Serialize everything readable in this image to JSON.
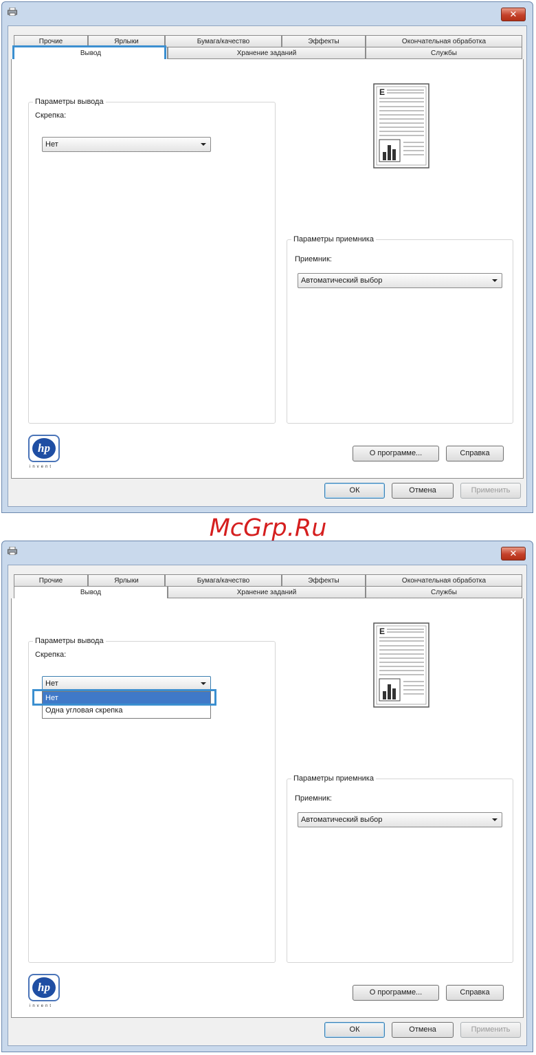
{
  "watermark": "McGrp.Ru",
  "titlebar": {
    "close_label": "✕"
  },
  "tabs": {
    "row1": [
      "Прочие",
      "Ярлыки",
      "Бумага/качество",
      "Эффекты",
      "Окончательная обработка"
    ],
    "row2": [
      "Вывод",
      "Хранение заданий",
      "Службы"
    ]
  },
  "output_group": {
    "title": "Параметры вывода",
    "staple_label": "Скрепка:",
    "staple_value": "Нет",
    "staple_options": [
      "Нет",
      "Одна угловая скрепка"
    ]
  },
  "receiver_group": {
    "title": "Параметры приемника",
    "receiver_label": "Приемник:",
    "receiver_value": "Автоматический выбор"
  },
  "logo": {
    "text": "hp",
    "tagline": "invent"
  },
  "buttons": {
    "about": "О программе...",
    "help": "Справка",
    "ok": "ОК",
    "cancel": "Отмена",
    "apply": "Применить"
  },
  "colors": {
    "highlight": "#3b8fd0",
    "watermark": "#d51f1f",
    "selected_item": "#3f79c8"
  },
  "icons": [
    "printer-icon",
    "close-icon",
    "dropdown-arrow-icon",
    "page-preview-icon",
    "hp-logo-icon"
  ]
}
